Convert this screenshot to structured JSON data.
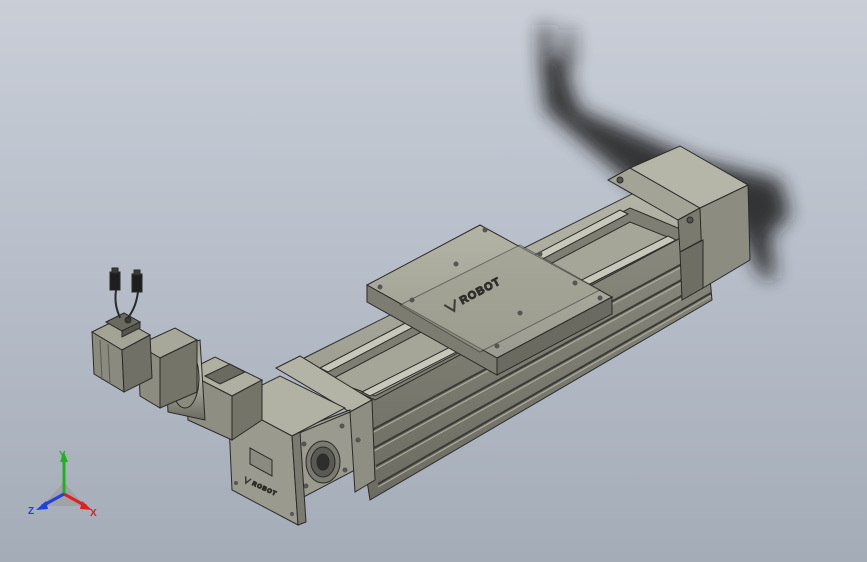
{
  "model": {
    "logo_text": "ROBOT",
    "logo_text_small": "ROBOT"
  },
  "triad": {
    "x_label": "X",
    "y_label": "Y",
    "z_label": "Z"
  },
  "colors": {
    "background_top": "#c9ced7",
    "background_bottom": "#a4acb8",
    "metal_light": "#a8a89a",
    "metal_mid": "#8c8c80",
    "metal_dark": "#6e6e64",
    "edge": "#2a2a28",
    "shadow": "#1c1c1c",
    "axis_x": "#e02020",
    "axis_y": "#20b020",
    "axis_z": "#2040e0"
  }
}
